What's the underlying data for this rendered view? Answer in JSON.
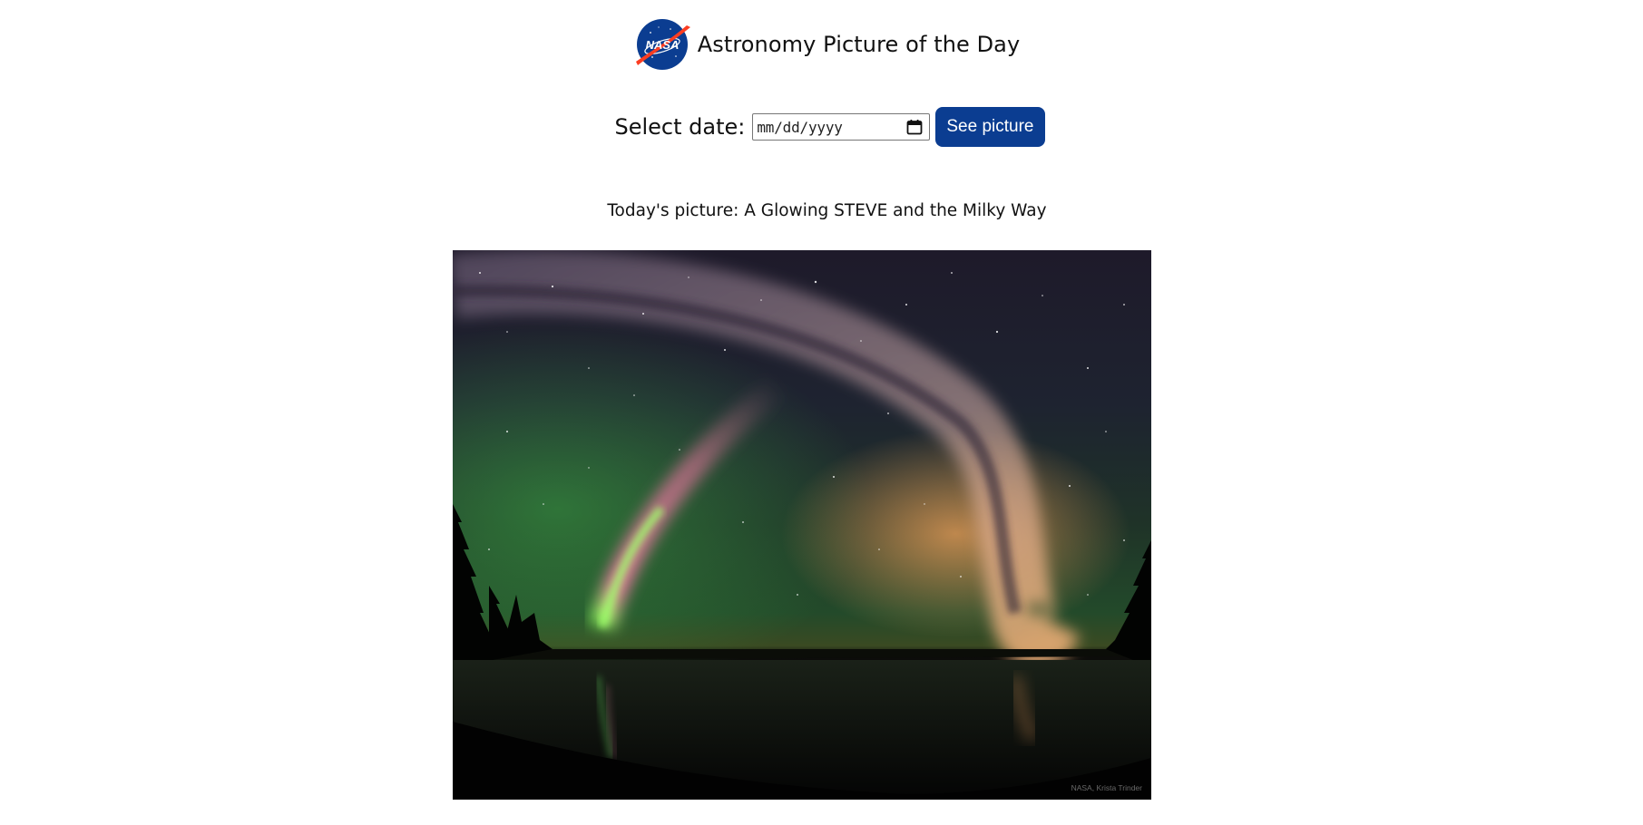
{
  "header": {
    "logo_text": "NASA",
    "title": "Astronomy Picture of the Day",
    "logo_icon": "nasa-meatball-logo"
  },
  "date_picker": {
    "label": "Select date:",
    "placeholder": "mm/dd/yyyy",
    "icon": "calendar-icon",
    "button_label": "See picture",
    "button_color": "#0b3d91"
  },
  "picture": {
    "caption": "Today's picture: A Glowing STEVE and the Milky Way",
    "credit": "NASA, Krista Trinder",
    "alt_subject": "STEVE aurora arc and the Milky Way over a lake"
  }
}
